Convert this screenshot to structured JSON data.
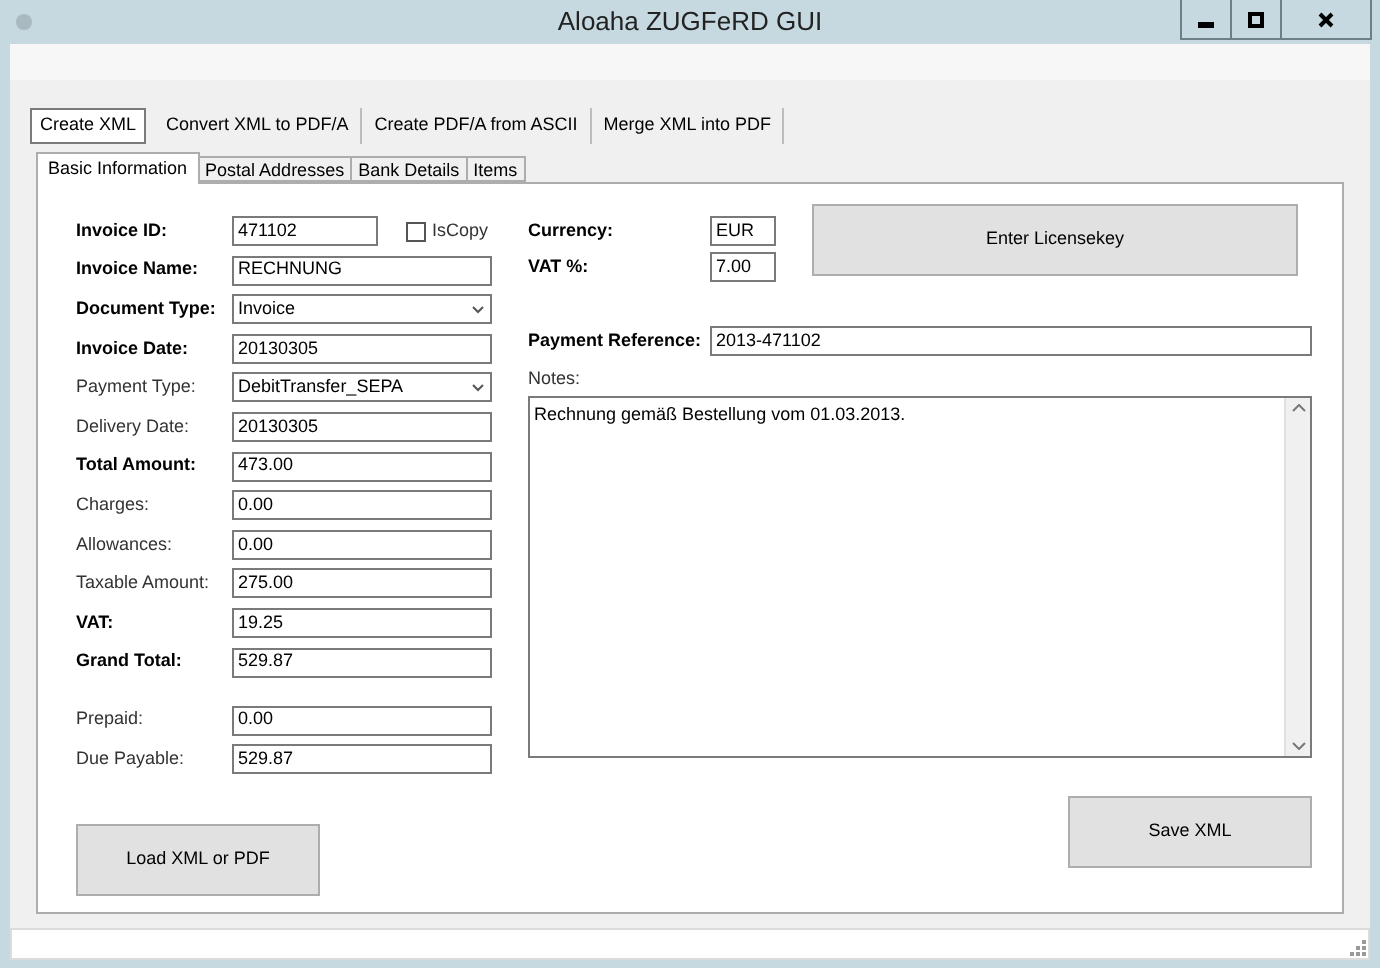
{
  "window": {
    "title": "Aloaha ZUGFeRD GUI"
  },
  "main_tabs": [
    {
      "label": "Create XML",
      "selected": true
    },
    {
      "label": "Convert XML to PDF/A",
      "selected": false
    },
    {
      "label": "Create PDF/A from ASCII",
      "selected": false
    },
    {
      "label": "Merge XML into PDF",
      "selected": false
    }
  ],
  "sub_tabs": [
    {
      "label": "Basic Information",
      "selected": true
    },
    {
      "label": "Postal Addresses",
      "selected": false
    },
    {
      "label": "Bank Details",
      "selected": false
    },
    {
      "label": "Items",
      "selected": false
    }
  ],
  "field_groups": [
    [
      {
        "label": "Invoice ID:",
        "bold": true,
        "kind": "text",
        "value": "471102"
      },
      {
        "label": "Invoice Name:",
        "bold": true,
        "kind": "text",
        "value": "RECHNUNG"
      },
      {
        "label": "Document Type:",
        "bold": true,
        "kind": "select",
        "value": "Invoice"
      },
      {
        "label": "Invoice Date:",
        "bold": true,
        "kind": "text",
        "value": "20130305"
      },
      {
        "label": "Payment Type:",
        "bold": false,
        "kind": "select",
        "value": "DebitTransfer_SEPA"
      },
      {
        "label": "Delivery Date:",
        "bold": false,
        "kind": "text",
        "value": "20130305"
      },
      {
        "label": "Total Amount:",
        "bold": true,
        "kind": "text",
        "value": "473.00"
      },
      {
        "label": "Charges:",
        "bold": false,
        "kind": "text",
        "value": "0.00"
      },
      {
        "label": "Allowances:",
        "bold": false,
        "kind": "text",
        "value": "0.00"
      },
      {
        "label": "Taxable Amount:",
        "bold": false,
        "kind": "text",
        "value": "275.00"
      },
      {
        "label": "VAT:",
        "bold": true,
        "kind": "text",
        "value": "19.25"
      },
      {
        "label": "Grand Total:",
        "bold": true,
        "kind": "text",
        "value": "529.87"
      }
    ],
    [
      {
        "label": "Prepaid:",
        "bold": false,
        "kind": "text",
        "value": "0.00"
      },
      {
        "label": "Due Payable:",
        "bold": false,
        "kind": "text",
        "value": "529.87"
      }
    ]
  ],
  "is_copy": {
    "label": "IsCopy",
    "checked": false
  },
  "currency": {
    "label": "Currency:",
    "value": "EUR"
  },
  "vat_percent": {
    "label": "VAT %:",
    "value": "7.00"
  },
  "license_button": "Enter Licensekey",
  "payment_reference": {
    "label": "Payment Reference:",
    "value": "2013-471102"
  },
  "notes": {
    "label": "Notes:",
    "value": "Rechnung gemäß Bestellung vom 01.03.2013."
  },
  "buttons": [
    "Load XML or PDF",
    "Save XML"
  ]
}
